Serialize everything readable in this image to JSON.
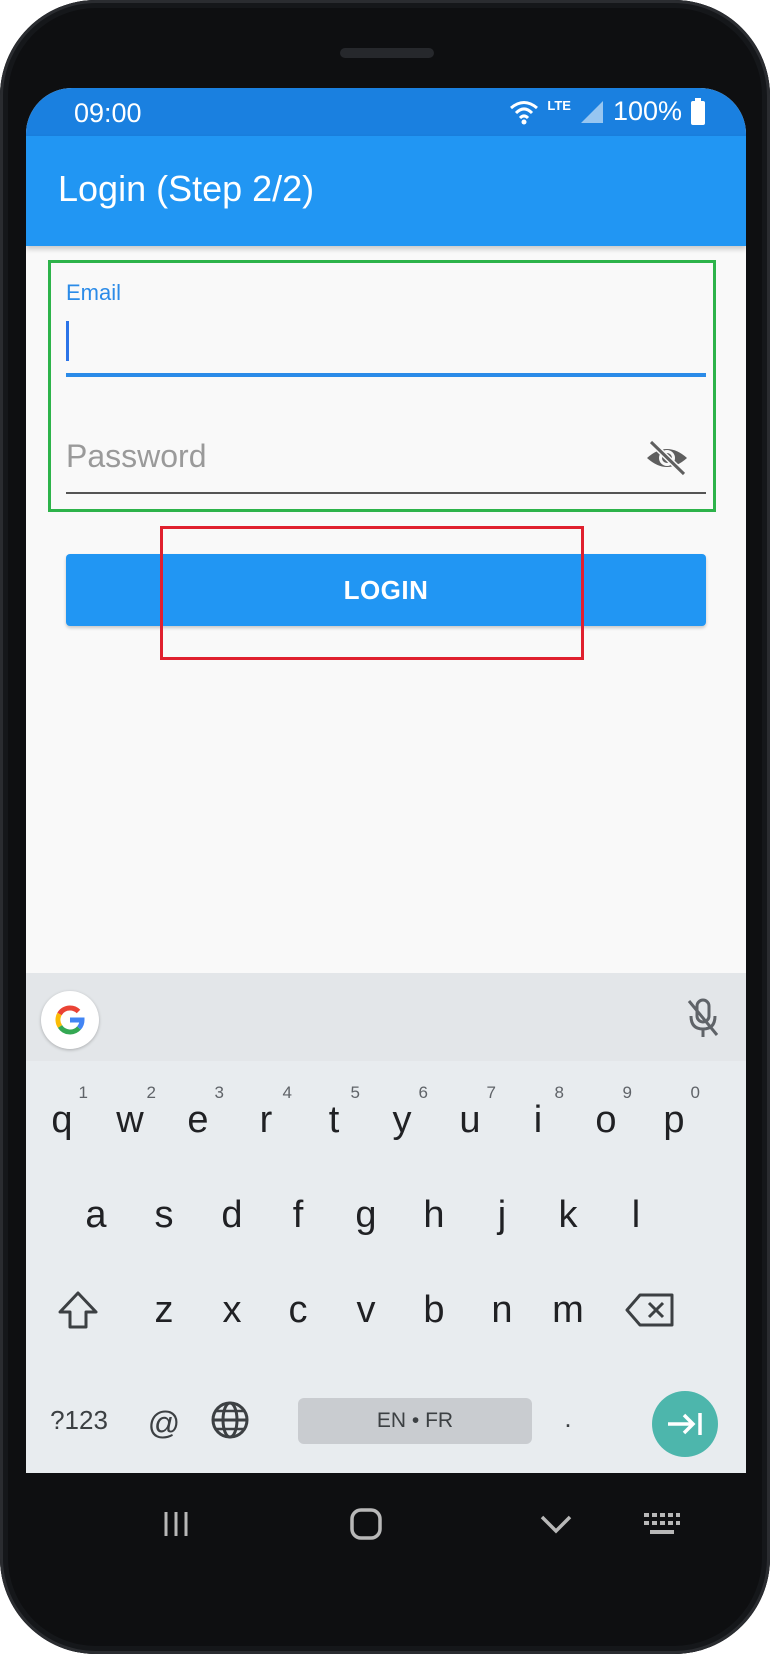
{
  "status_bar": {
    "time": "09:00",
    "network": "LTE",
    "battery": "100%",
    "icons": [
      "wifi-icon",
      "signal-icon",
      "battery-icon"
    ]
  },
  "app_bar": {
    "title": "Login (Step 2/2)"
  },
  "form": {
    "email": {
      "label": "Email",
      "value": ""
    },
    "password": {
      "placeholder": "Password",
      "toggle_icon": "eye-off-icon"
    }
  },
  "login_button": {
    "label": "LOGIN"
  },
  "keyboard": {
    "toolbar_icons": [
      "google-icon",
      "mic-off-icon"
    ],
    "row1": [
      {
        "key": "q",
        "hint": "1"
      },
      {
        "key": "w",
        "hint": "2"
      },
      {
        "key": "e",
        "hint": "3"
      },
      {
        "key": "r",
        "hint": "4"
      },
      {
        "key": "t",
        "hint": "5"
      },
      {
        "key": "y",
        "hint": "6"
      },
      {
        "key": "u",
        "hint": "7"
      },
      {
        "key": "i",
        "hint": "8"
      },
      {
        "key": "o",
        "hint": "9"
      },
      {
        "key": "p",
        "hint": "0"
      }
    ],
    "row2": [
      "a",
      "s",
      "d",
      "f",
      "g",
      "h",
      "j",
      "k",
      "l"
    ],
    "row3": [
      "z",
      "x",
      "c",
      "v",
      "b",
      "n",
      "m"
    ],
    "symbols_key": "?123",
    "at_key": "@",
    "language_label": "EN • FR",
    "period_key": "."
  },
  "colors": {
    "app_bar": "#2196f3",
    "status_bar": "#1a80e0",
    "accent": "#2b8be8",
    "form_highlight": "#2db34a",
    "button_highlight": "#e0202e",
    "enter_key": "#4db6ac"
  },
  "nav_bar": {
    "icons": [
      "recents-icon",
      "home-icon",
      "back-icon",
      "keyboard-icon"
    ]
  }
}
